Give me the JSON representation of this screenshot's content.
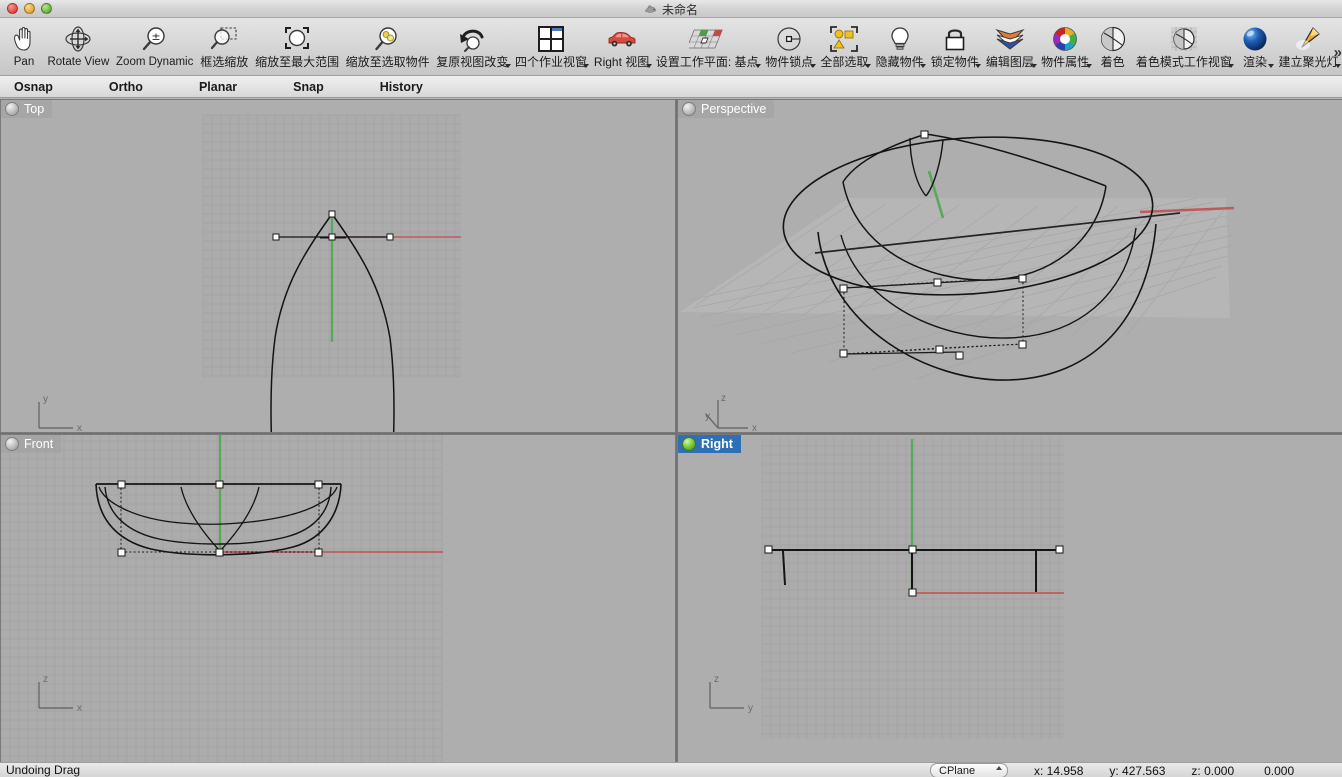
{
  "window": {
    "title": "未命名",
    "app_icon": "rhino-icon",
    "buttons": [
      {
        "name": "close",
        "color": "#e2453c"
      },
      {
        "name": "minimize",
        "color": "#e3a53a"
      },
      {
        "name": "maximize",
        "color": "#66b13a"
      }
    ]
  },
  "toolbar": {
    "overflow_indicator": "»",
    "items": [
      {
        "label": "Pan",
        "icon": "hand-icon",
        "cjk": false,
        "dropdown": false
      },
      {
        "label": "Rotate View",
        "icon": "rotate-view-icon",
        "cjk": false,
        "dropdown": false
      },
      {
        "label": "Zoom Dynamic",
        "icon": "zoom-dynamic-icon",
        "cjk": false,
        "dropdown": false
      },
      {
        "label": "框选缩放",
        "icon": "zoom-window-icon",
        "cjk": true,
        "dropdown": false
      },
      {
        "label": "缩放至最大范围",
        "icon": "zoom-extents-icon",
        "cjk": true,
        "dropdown": false
      },
      {
        "label": "缩放至选取物件",
        "icon": "zoom-selected-icon",
        "cjk": true,
        "dropdown": false
      },
      {
        "label": "复原视图改变",
        "icon": "undo-view-icon",
        "cjk": true,
        "dropdown": true
      },
      {
        "label": "四个作业视窗",
        "icon": "four-viewports-icon",
        "cjk": true,
        "dropdown": true
      },
      {
        "label": "Right 视图",
        "icon": "car-icon",
        "cjk": true,
        "dropdown": true
      },
      {
        "label": "设置工作平面: 基点",
        "icon": "set-cplane-origin-icon",
        "cjk": true,
        "dropdown": true
      },
      {
        "label": "物件锁点",
        "icon": "osnap-icon",
        "cjk": true,
        "dropdown": true
      },
      {
        "label": "全部选取",
        "icon": "select-all-icon",
        "cjk": true,
        "dropdown": true
      },
      {
        "label": "隐藏物件",
        "icon": "hide-objects-icon",
        "cjk": true,
        "dropdown": true
      },
      {
        "label": "锁定物件",
        "icon": "lock-objects-icon",
        "cjk": true,
        "dropdown": true
      },
      {
        "label": "编辑图层",
        "icon": "edit-layers-icon",
        "cjk": true,
        "dropdown": true
      },
      {
        "label": "物件属性",
        "icon": "object-properties-icon",
        "cjk": true,
        "dropdown": true
      },
      {
        "label": "着色",
        "icon": "shade-icon",
        "cjk": true,
        "dropdown": false
      },
      {
        "label": "着色模式工作视窗",
        "icon": "shaded-viewport-icon",
        "cjk": true,
        "dropdown": true
      },
      {
        "label": "渲染",
        "icon": "render-icon",
        "cjk": true,
        "dropdown": true
      },
      {
        "label": "建立聚光灯",
        "icon": "spotlight-icon",
        "cjk": true,
        "dropdown": true
      }
    ]
  },
  "toggles": [
    {
      "label": "Osnap",
      "active": false
    },
    {
      "label": "Ortho",
      "active": false
    },
    {
      "label": "Planar",
      "active": false
    },
    {
      "label": "Snap",
      "active": false
    },
    {
      "label": "History",
      "active": false
    }
  ],
  "viewports": [
    {
      "name": "Top",
      "active": false,
      "sphere": "grey-sphere",
      "axes": {
        "vertical": "y",
        "horizontal": "x",
        "diagonal": null
      }
    },
    {
      "name": "Perspective",
      "active": false,
      "sphere": "grey-sphere",
      "axes": {
        "vertical": "z",
        "horizontal": "x",
        "diagonal": "y"
      }
    },
    {
      "name": "Front",
      "active": false,
      "sphere": "grey-sphere",
      "axes": {
        "vertical": "z",
        "horizontal": "x",
        "diagonal": null
      }
    },
    {
      "name": "Right",
      "active": true,
      "sphere": "green-sphere",
      "axes": {
        "vertical": "z",
        "horizontal": "y",
        "diagonal": null
      }
    }
  ],
  "statusbar": {
    "message": "Undoing Drag",
    "cplane_label": "CPlane",
    "x": "x: 14.958",
    "y": "y: 427.563",
    "z": "z: 0.000",
    "extra": "0.000"
  },
  "colors": {
    "x_axis": "#c05a5a",
    "y_axis": "#5aa85a",
    "geometry": "#1a1a1a",
    "viewport_bg": "#aeaeae",
    "grid": "#a4a4a4",
    "active_title": "#2f6fb5"
  }
}
